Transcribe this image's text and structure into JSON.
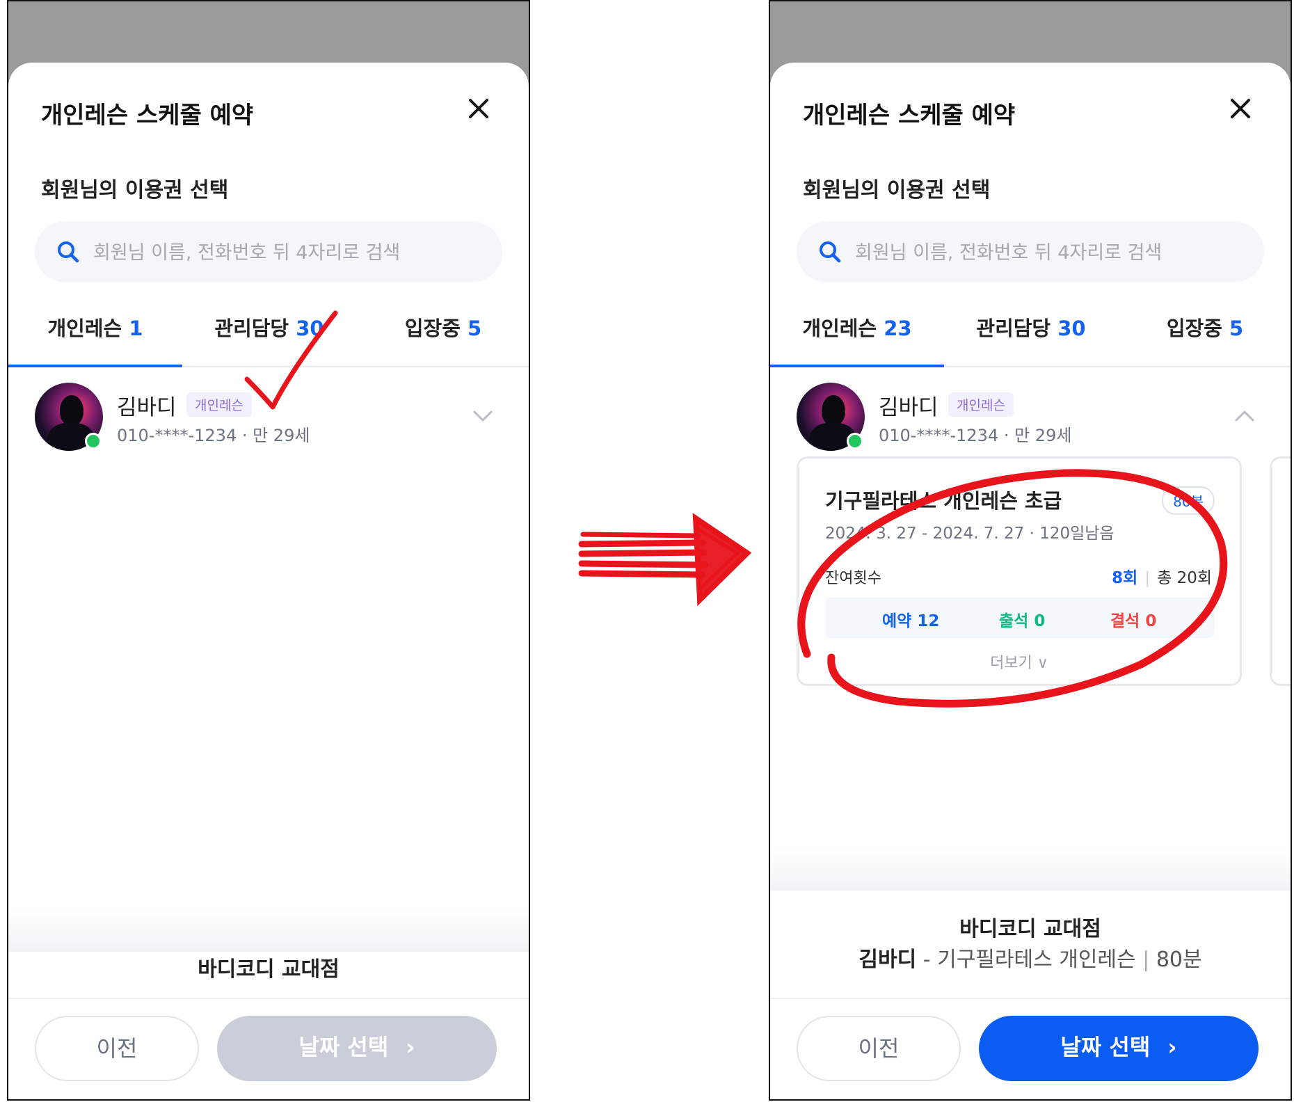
{
  "colors": {
    "accent": "#1462f0",
    "primary_button": "#0b5cf0",
    "disabled_button": "#c9ced8",
    "annotation_red": "#e8141b"
  },
  "left_screen": {
    "title": "개인레슨 스케줄 예약",
    "subtitle": "회원님의 이용권 선택",
    "search": {
      "placeholder": "회원님 이름, 전화번호 뒤 4자리로 검색",
      "value": ""
    },
    "tabs": [
      {
        "label": "개인레슨",
        "count": "1",
        "active": true
      },
      {
        "label": "관리담당",
        "count": "30",
        "active": false
      },
      {
        "label": "입장중",
        "count": "5",
        "active": false
      }
    ],
    "member": {
      "name": "김바디",
      "badge": "개인레슨",
      "info": "010-****-1234 · 만 29세",
      "expanded": false
    },
    "footer": {
      "branch": "바디코디 교대점"
    },
    "buttons": {
      "prev": "이전",
      "next": "날짜 선택",
      "next_enabled": false
    }
  },
  "right_screen": {
    "title": "개인레슨 스케줄 예약",
    "subtitle": "회원님의 이용권 선택",
    "search": {
      "placeholder": "회원님 이름, 전화번호 뒤 4자리로 검색",
      "value": ""
    },
    "tabs": [
      {
        "label": "개인레슨",
        "count": "23",
        "active": true
      },
      {
        "label": "관리담당",
        "count": "30",
        "active": false
      },
      {
        "label": "입장중",
        "count": "5",
        "active": false
      }
    ],
    "member": {
      "name": "김바디",
      "badge": "개인레슨",
      "info": "010-****-1234 · 만 29세",
      "expanded": true
    },
    "ticket": {
      "name": "기구필라테스 개인레슨 초급",
      "duration": "80분",
      "period": "2024. 3. 27 - 2024. 7. 27 · 120일남음",
      "remaining_label": "잔여횟수",
      "remaining_value": "8회",
      "total": "총 20회",
      "stats": {
        "reserved": "예약 12",
        "attended": "출석 0",
        "absent": "결석 0"
      },
      "more": "더보기 ∨"
    },
    "footer": {
      "branch": "바디코디 교대점",
      "member_name": "김바디",
      "dash": " - ",
      "ticket_name": "기구필라테스 개인레슨",
      "sep": " | ",
      "duration": "80분"
    },
    "buttons": {
      "prev": "이전",
      "next": "날짜 선택",
      "next_enabled": true
    }
  },
  "annotations": [
    "red-checkmark",
    "red-arrow",
    "red-circle"
  ]
}
